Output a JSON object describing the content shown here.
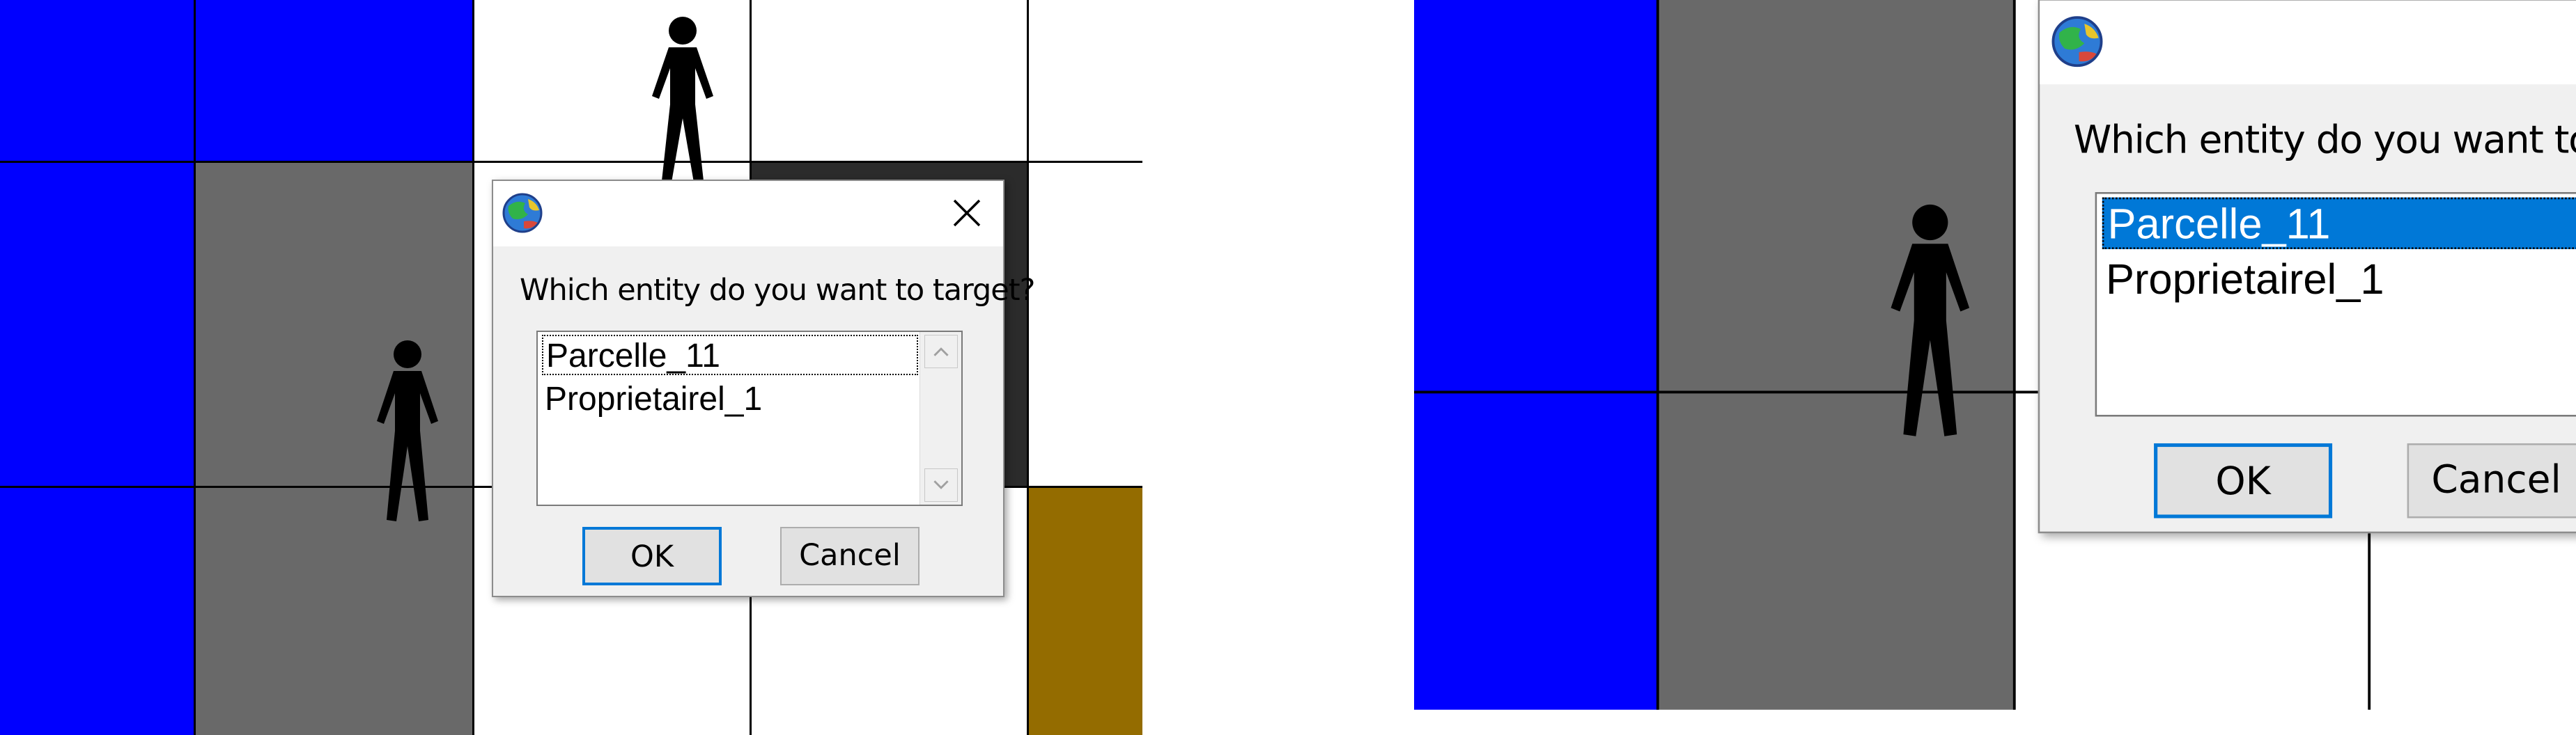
{
  "colors": {
    "blue_cell": "#0000ff",
    "gray_cell": "#696969",
    "brown_cell": "#946c00",
    "dark_border": "#2b2b2b",
    "grid_line": "#000000",
    "selection": "#0078d7"
  },
  "panels": [
    {
      "dialog": {
        "icon": "globe-icon",
        "close_icon": "close-icon",
        "prompt": "Which entity do you want to target?",
        "items": [
          {
            "label": "Parcelle_11",
            "selected": true,
            "highlighted": false
          },
          {
            "label": "Proprietairel_1",
            "selected": false,
            "highlighted": false
          }
        ],
        "ok_label": "OK",
        "cancel_label": "Cancel"
      }
    },
    {
      "dialog": {
        "icon": "globe-icon",
        "close_icon": "close-icon",
        "prompt": "Which entity do you want to target?",
        "items": [
          {
            "label": "Parcelle_11",
            "selected": true,
            "highlighted": true
          },
          {
            "label": "Proprietairel_1",
            "selected": false,
            "highlighted": false
          }
        ],
        "ok_label": "OK",
        "cancel_label": "Cancel"
      }
    }
  ]
}
